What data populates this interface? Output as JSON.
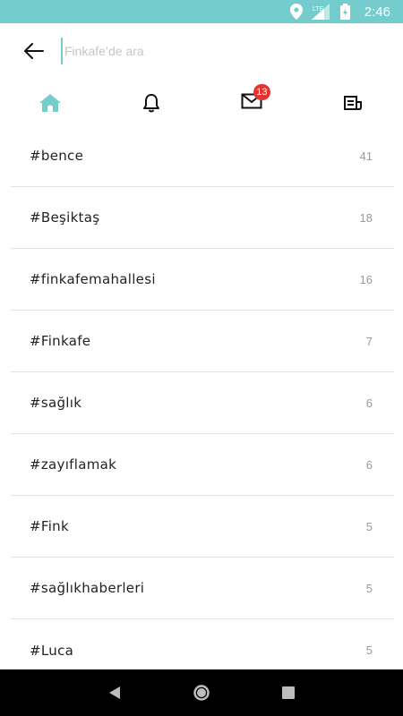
{
  "status_bar": {
    "time": "2:46",
    "network": "LTE",
    "icons": [
      "location-icon",
      "signal-icon",
      "battery-charging-icon"
    ]
  },
  "search": {
    "placeholder": "Finkafe’de ara",
    "value": ""
  },
  "nav": {
    "items": [
      {
        "icon": "home-icon",
        "active": true
      },
      {
        "icon": "bell-icon",
        "active": false
      },
      {
        "icon": "mail-icon",
        "active": false,
        "badge": "13"
      },
      {
        "icon": "news-icon",
        "active": false
      }
    ]
  },
  "colors": {
    "accent": "#74cccd",
    "badge": "#e5342f",
    "divider": "#e3e3e3"
  },
  "tags": [
    {
      "name": "#bence",
      "count": "41"
    },
    {
      "name": "#Beşiktaş",
      "count": "18"
    },
    {
      "name": "#finkafemahallesi",
      "count": "16"
    },
    {
      "name": "#Finkafe",
      "count": "7"
    },
    {
      "name": "#sağlık",
      "count": "6"
    },
    {
      "name": "#zayıflamak",
      "count": "6"
    },
    {
      "name": "#Fink",
      "count": "5"
    },
    {
      "name": "#sağlıkhaberleri",
      "count": "5"
    },
    {
      "name": "#Luca",
      "count": "5"
    }
  ],
  "system_nav": [
    "back-icon",
    "home-circle-icon",
    "recents-icon"
  ]
}
